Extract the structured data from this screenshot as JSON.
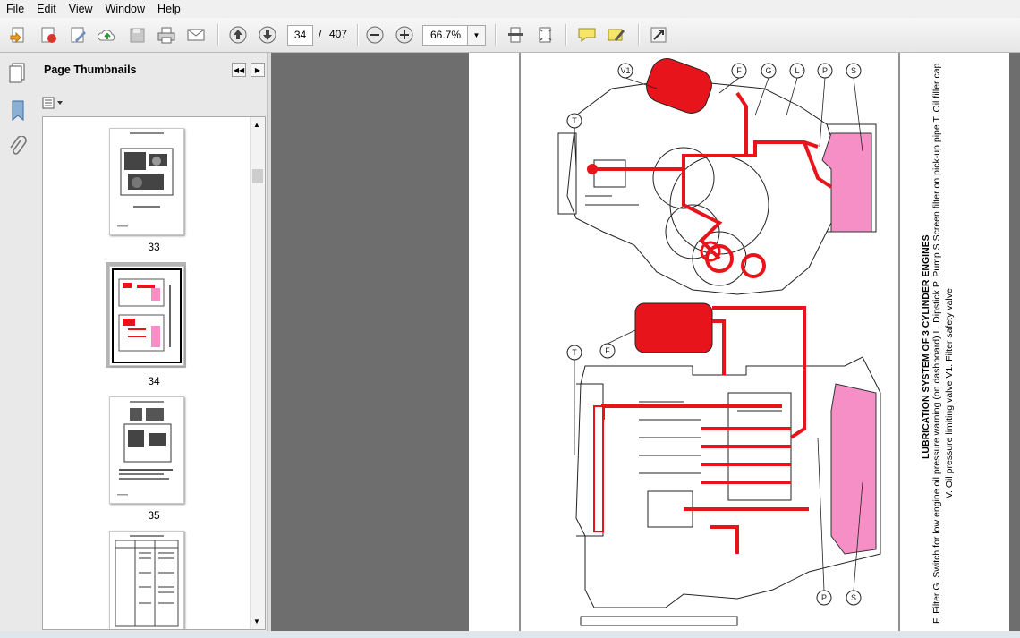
{
  "menu": [
    "File",
    "Edit",
    "View",
    "Window",
    "Help"
  ],
  "toolbar": {
    "page_current": "34",
    "page_separator": "/",
    "page_total": "407",
    "zoom": "66.7%",
    "zoom_dropdown_icon": "chevron-down-icon"
  },
  "panel": {
    "title": "Page Thumbnails"
  },
  "thumbnails": [
    {
      "label": "33"
    },
    {
      "label": "34",
      "selected": true
    },
    {
      "label": "35"
    }
  ],
  "document": {
    "caption_title": "LUBRICATION SYSTEM OF 3 CYLINDER ENGINES",
    "caption_line1": "F. Filter G. Switch for low engine oil pressure warning (on dashboard) L. Dipstick P. Pump S.Screen filter on pick-up pipe T. Oil filler cap",
    "caption_line2": "V. Oil pressure limiting valve V1. Filter safety valve",
    "callouts_top": [
      "V1",
      "F",
      "G",
      "L",
      "P",
      "S",
      "T"
    ],
    "callouts_bottom": [
      "F",
      "T",
      "P",
      "S"
    ]
  },
  "colors": {
    "oil_red": "#e8141c",
    "sump_pink": "#f58fc6",
    "panel_bg": "#e9e9e9",
    "doc_bg": "#6e6e6e"
  }
}
